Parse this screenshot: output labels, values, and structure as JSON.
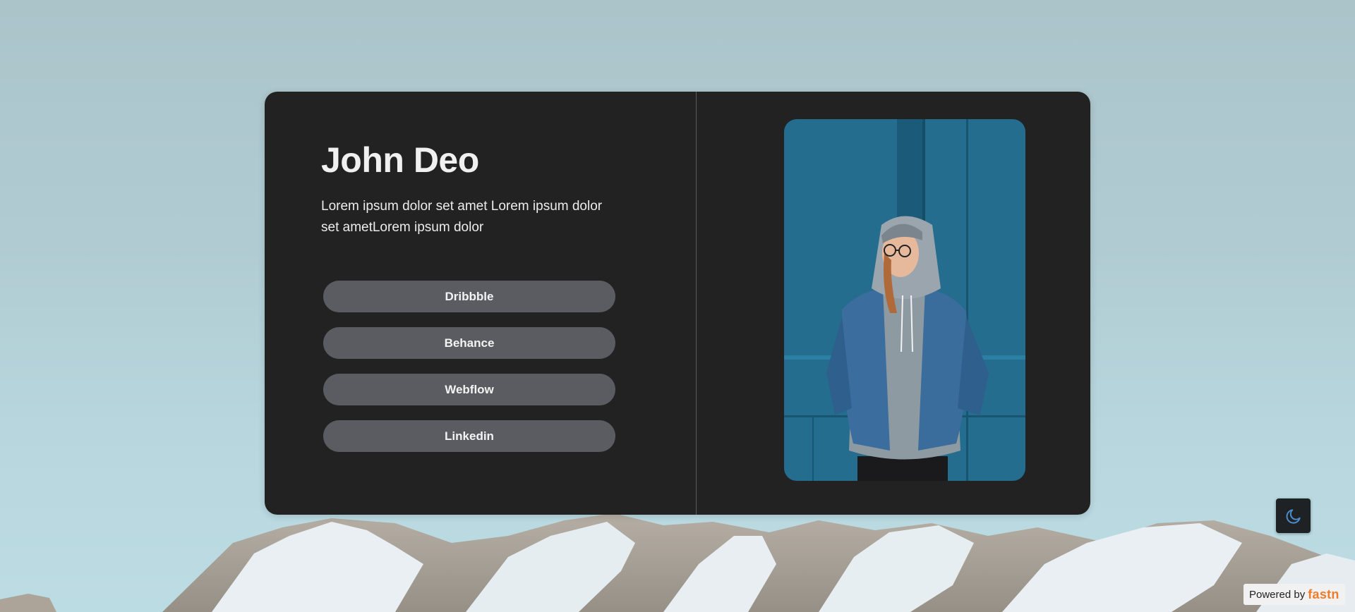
{
  "profile": {
    "name": "John Deo",
    "bio": "Lorem ipsum dolor set amet Lorem ipsum dolor set ametLorem ipsum dolor"
  },
  "links": [
    {
      "label": "Dribbble"
    },
    {
      "label": "Behance"
    },
    {
      "label": "Webflow"
    },
    {
      "label": "Linkedin"
    }
  ],
  "photo": {
    "alt": "Smiling person in denim jacket and grey hoodie against a blue wall"
  },
  "theme_toggle": {
    "icon": "moon-icon",
    "accent": "#4a8fd0"
  },
  "footer": {
    "powered_by": "Powered by",
    "brand": "fastn",
    "brand_color": "#ef7c2a"
  }
}
